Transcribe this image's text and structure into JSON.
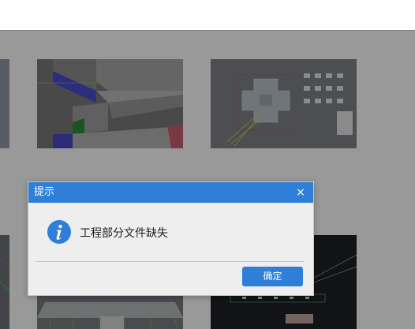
{
  "dialog": {
    "title": "提示",
    "close_symbol": "×",
    "message": "工程部分文件缺失",
    "confirm_label": "确定",
    "icon": "info-icon"
  },
  "colors": {
    "accent": "#2f7fd8",
    "dialog_bg": "#eeeeee",
    "overlay": "rgba(0,0,0,0.40)"
  },
  "thumbnails": [
    {
      "name": "model-3d-partial-left"
    },
    {
      "name": "model-3d-walls"
    },
    {
      "name": "floor-plan-drawing"
    },
    {
      "name": "model-3d-partial-left-bottom"
    },
    {
      "name": "model-3d-grid-bottom"
    },
    {
      "name": "cad-drawing-dark"
    }
  ]
}
